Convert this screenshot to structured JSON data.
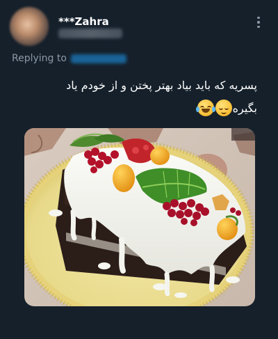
{
  "author": {
    "display_name": "***Zahra"
  },
  "more_icon": "more-horizontal-icon",
  "reply": {
    "label": "Replying to"
  },
  "tweet": {
    "text_line1": "پسریه که باید بیاد بهتر پختن و از خودم یاد",
    "text_line2": "بگیره",
    "emojis": [
      "face-with-tears-of-joy-icon",
      "relieved-face-icon"
    ]
  },
  "media": {
    "subject": "photo-of-frosted-chocolate-cake"
  },
  "colors": {
    "background": "#15202b",
    "text": "#ffffff",
    "secondary": "#8b98a5",
    "accent": "#1d9bf0"
  }
}
